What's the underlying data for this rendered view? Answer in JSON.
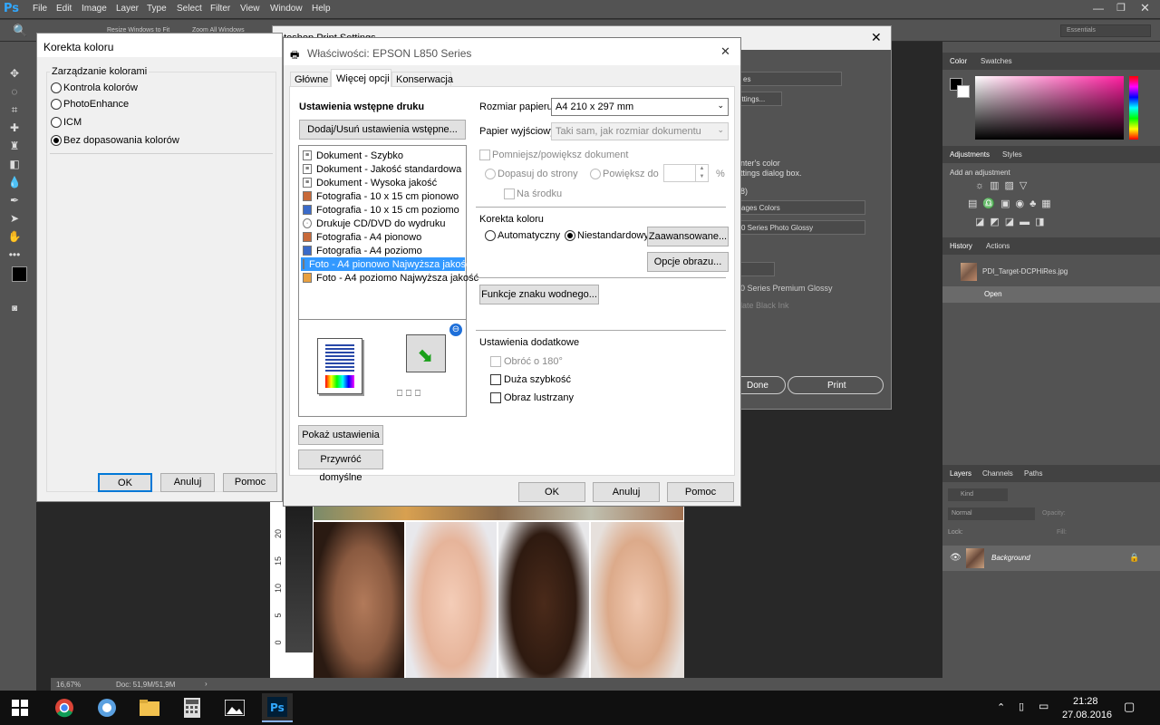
{
  "photoshop": {
    "logo": "Ps",
    "menu": [
      "File",
      "Edit",
      "Image",
      "Layer",
      "Type",
      "Select",
      "Filter",
      "View",
      "Window",
      "Help"
    ],
    "opt_reset": "Resize Windows to Fit",
    "opt_zoom_all": "Zoom All Windows",
    "workspace": "Essentials",
    "status_zoom": "16,67%",
    "status_doc": "Doc: 51,9M/51,9M",
    "panels": {
      "color_tab": "Color",
      "swatches_tab": "Swatches",
      "adjustments_tab": "Adjustments",
      "styles_tab": "Styles",
      "add_adjustment": "Add an adjustment",
      "history_tab": "History",
      "actions_tab": "Actions",
      "history_file": "PDI_Target-DCPHiRes.jpg",
      "history_open": "Open",
      "layers_tab": "Layers",
      "channels_tab": "Channels",
      "paths_tab": "Paths",
      "kind": "Kind",
      "blend": "Normal",
      "opacity": "Opacity:",
      "lock": "Lock:",
      "fill": "Fill:",
      "layer_name": "Background"
    },
    "ruler_numbers": [
      "20",
      "15",
      "10",
      "5",
      "0"
    ]
  },
  "print_settings": {
    "title": "otoshop Print Settings",
    "frag_dropdown": "es",
    "frag_settings_btn": "ettings...",
    "frag_text1": "nter's color",
    "frag_text2": "ttings dialog box.",
    "frag_paren": "8)",
    "frag_sel1": "ages Colors",
    "frag_sel2": "0 Series Photo Glossy",
    "frag_text3": "0 Series Premium Glossy",
    "frag_text4": "late Black Ink",
    "done": "Done",
    "print": "Print"
  },
  "korekta": {
    "title": "Korekta koloru",
    "group": "Zarządzanie kolorami",
    "options": [
      "Kontrola kolorów",
      "PhotoEnhance",
      "ICM",
      "Bez dopasowania kolorów"
    ],
    "selected_index": 3,
    "ok": "OK",
    "cancel": "Anuluj",
    "help": "Pomoc"
  },
  "epson": {
    "title": "Właściwości: EPSON L850 Series",
    "tabs": [
      "Główne",
      "Więcej opcji",
      "Konserwacja"
    ],
    "active_tab_index": 1,
    "presets_heading": "Ustawienia wstępne druku",
    "presets_btn": "Dodaj/Usuń ustawienia wstępne...",
    "presets": [
      "Dokument - Szybko",
      "Dokument - Jakość standardowa",
      "Dokument - Wysoka jakość",
      "Fotografia - 10 x 15 cm pionowo",
      "Fotografia - 10 x 15 cm poziomo",
      "Drukuje CD/DVD do wydruku",
      "Fotografia - A4 pionowo",
      "Fotografia - A4 poziomo",
      "Foto - A4 pionowo Najwyższa jakość",
      "Foto - A4 poziomo Najwyższa jakość"
    ],
    "selected_preset_index": 8,
    "show_settings_btn": "Pokaż ustawienia",
    "restore_btn": "Przywróć domyślne",
    "paper_size_label": "Rozmiar papieru",
    "paper_size_value": "A4 210 x 297 mm",
    "output_paper_label": "Papier wyjściowy",
    "output_paper_value": "Taki sam, jak rozmiar dokumentu",
    "reduce_enlarge": "Pomniejsz/powiększ dokument",
    "fit_page": "Dopasuj do strony",
    "zoom_to": "Powiększ do",
    "percent": "%",
    "center": "Na środku",
    "color_correction_label": "Korekta koloru",
    "auto": "Automatyczny",
    "custom": "Niestandardowy",
    "advanced_btn": "Zaawansowane...",
    "image_options_btn": "Opcje obrazu...",
    "watermark_btn": "Funkcje znaku wodnego...",
    "extra_label": "Ustawienia dodatkowe",
    "rotate": "Obróć o 180°",
    "high_speed": "Duża szybkość",
    "mirror": "Obraz lustrzany",
    "ok": "OK",
    "cancel": "Anuluj",
    "help": "Pomoc"
  },
  "taskbar": {
    "time": "21:28",
    "date": "27.08.2016"
  },
  "colors": {
    "ps_panel": "#535353",
    "ps_dark": "#282828",
    "dialog_bg": "#f0f0f0",
    "selection": "#3399ff",
    "accent_btn": "#0078d7"
  }
}
